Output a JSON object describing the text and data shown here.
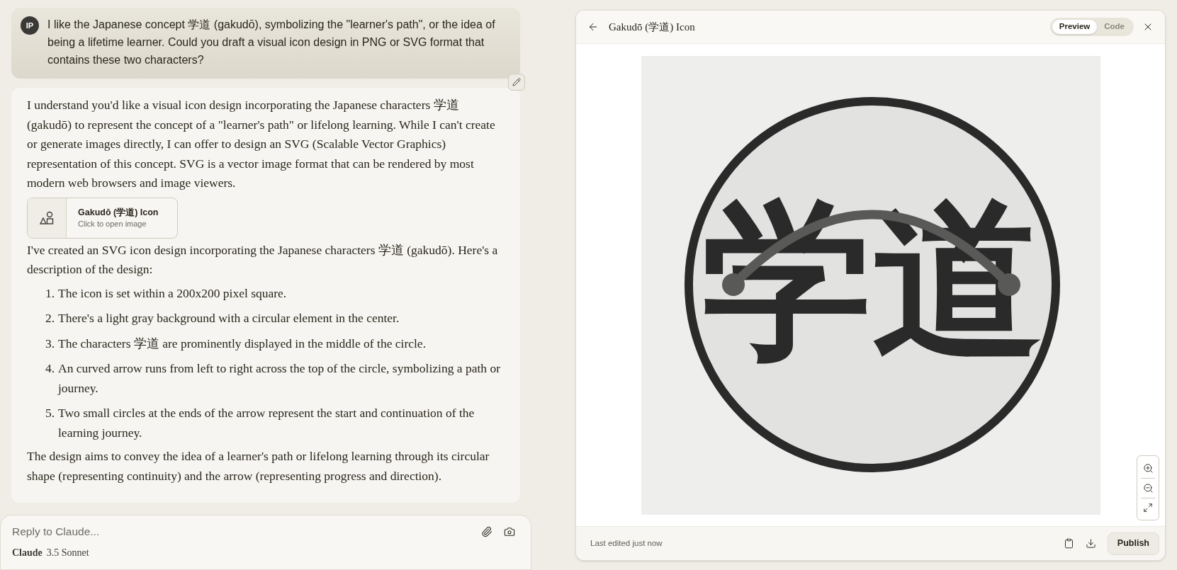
{
  "user_message": {
    "avatar": "IP",
    "text": "I like the Japanese concept 学道 (gakudō), symbolizing the \"learner's path\", or the idea of being a lifetime learner. Could you draft a visual icon design in PNG or SVG format that contains these two characters?"
  },
  "assistant_message": {
    "intro": "I understand you'd like a visual icon design incorporating the Japanese characters 学道 (gakudō) to represent the concept of a \"learner's path\" or lifelong learning. While I can't create or generate images directly, I can offer to design an SVG (Scalable Vector Graphics) representation of this concept. SVG is a vector image format that can be rendered by most modern web browsers and image viewers.",
    "artifact_card": {
      "title": "Gakudō (学道) Icon",
      "subtitle": "Click to open image"
    },
    "paragraph": "I've created an SVG icon design incorporating the Japanese characters 学道 (gakudō). Here's a description of the design:",
    "list": [
      {
        "number": "1.",
        "text": "The icon is set within a 200x200 pixel square."
      },
      {
        "number": "2.",
        "text": "There's a light gray background with a circular element in the center."
      },
      {
        "number": "3.",
        "text": "The characters 学道 are prominently displayed in the middle of the circle."
      },
      {
        "number": "4.",
        "text": "An curved arrow runs from left to right across the top of the circle, symbolizing a path or journey."
      },
      {
        "number": "5.",
        "text": "Two small circles at the ends of the arrow represent the start and continuation of the learning journey."
      }
    ],
    "conclusion": "The design aims to convey the idea of a learner's path or lifelong learning through its circular shape (representing continuity) and the arrow (representing progress and direction)."
  },
  "composer": {
    "placeholder": "Reply to Claude...",
    "model_name": "Claude",
    "model_version": "3.5 Sonnet"
  },
  "artifact_panel": {
    "title": "Gakudō (学道) Icon",
    "tabs": [
      {
        "label": "Preview",
        "selected": true
      },
      {
        "label": "Code",
        "selected": false
      }
    ],
    "artwork": {
      "characters": "学道"
    },
    "footer_status": "Last edited just now",
    "publish_label": "Publish"
  }
}
